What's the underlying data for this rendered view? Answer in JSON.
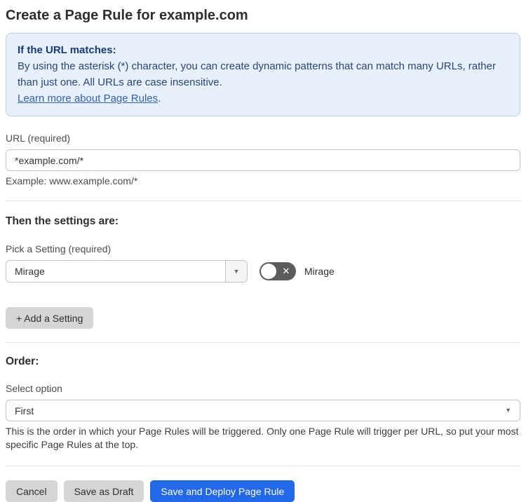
{
  "page": {
    "title": "Create a Page Rule for example.com"
  },
  "info_box": {
    "heading": "If the URL matches:",
    "body": "By using the asterisk (*) character, you can create dynamic patterns that can match many URLs, rather than just one. All URLs are case insensitive.",
    "link_label": "Learn more about Page Rules",
    "link_suffix": "."
  },
  "url_field": {
    "label": "URL (required)",
    "value": "*example.com/*",
    "hint": "Example: www.example.com/*"
  },
  "settings_section": {
    "heading": "Then the settings are:",
    "picker_label": "Pick a Setting (required)",
    "picker_value": "Mirage",
    "toggle_label": "Mirage",
    "toggle_state": "off",
    "add_button_label": "+ Add a Setting"
  },
  "order_section": {
    "heading": "Order:",
    "select_label": "Select option",
    "select_value": "First",
    "help_text": "This is the order in which your Page Rules will be triggered. Only one Page Rule will trigger per URL, so put your most specific Page Rules at the top."
  },
  "footer": {
    "cancel_label": "Cancel",
    "save_draft_label": "Save as Draft",
    "save_deploy_label": "Save and Deploy Page Rule"
  },
  "icons": {
    "dropdown_arrow": "▼",
    "toggle_x": "✕"
  },
  "colors": {
    "accent_blue": "#2268e8",
    "info_bg": "#e8f1fb",
    "info_border": "#b0d0ef",
    "info_text": "#27447f",
    "info_heading": "#14397d",
    "link_blue": "#2c5fc7",
    "toggle_off_bg": "#5c5c5c",
    "button_gray": "#d5d5d5"
  }
}
